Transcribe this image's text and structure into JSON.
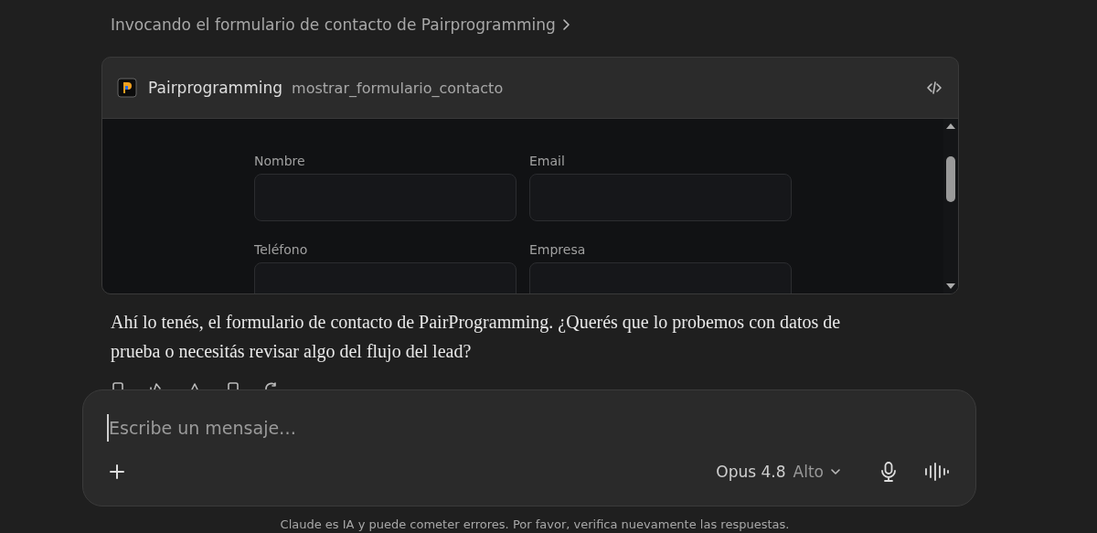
{
  "breadcrumb": {
    "text": "Invocando el formulario de contacto de Pairprogramming"
  },
  "tool_card": {
    "app": "Pairprogramming",
    "tool": "mostrar_formulario_contacto",
    "form": {
      "fields": [
        {
          "label": "Nombre"
        },
        {
          "label": "Email"
        },
        {
          "label": "Teléfono"
        },
        {
          "label": "Empresa"
        }
      ]
    }
  },
  "message": {
    "text": "Ahí lo tenés, el formulario de contacto de PairProgramming. ¿Querés que lo probemos con datos de prueba o necesitás revisar algo del flujo del lead?"
  },
  "composer": {
    "placeholder": "Escribe un mensaje…",
    "model": "Opus 4.8",
    "effort": "Alto"
  },
  "footer": {
    "text": "Claude es IA y puede cometer errores. Por favor, verifica nuevamente las respuestas."
  }
}
